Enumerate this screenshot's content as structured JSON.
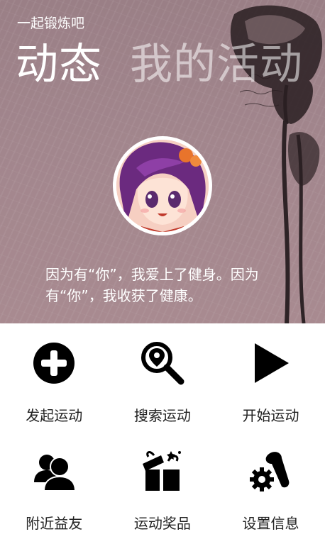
{
  "app": {
    "title": "一起锻炼吧"
  },
  "tabs": [
    {
      "label": "动态",
      "active": true
    },
    {
      "label": "我的活动",
      "active": false
    }
  ],
  "hero": {
    "quote": "因为有“你”，我爱上了健身。因为有“你”，我收获了健康。",
    "avatar_icon": "cartoon-girl-avatar"
  },
  "menu": [
    {
      "label": "发起运动",
      "icon": "plus-circle-icon"
    },
    {
      "label": "搜索运动",
      "icon": "location-search-icon"
    },
    {
      "label": "开始运动",
      "icon": "play-icon"
    },
    {
      "label": "附近益友",
      "icon": "people-icon"
    },
    {
      "label": "运动奖品",
      "icon": "gift-icon"
    },
    {
      "label": "设置信息",
      "icon": "settings-tools-icon"
    }
  ],
  "colors": {
    "hero_bg": "#a2868d",
    "icon": "#000000",
    "text": "#222222"
  }
}
